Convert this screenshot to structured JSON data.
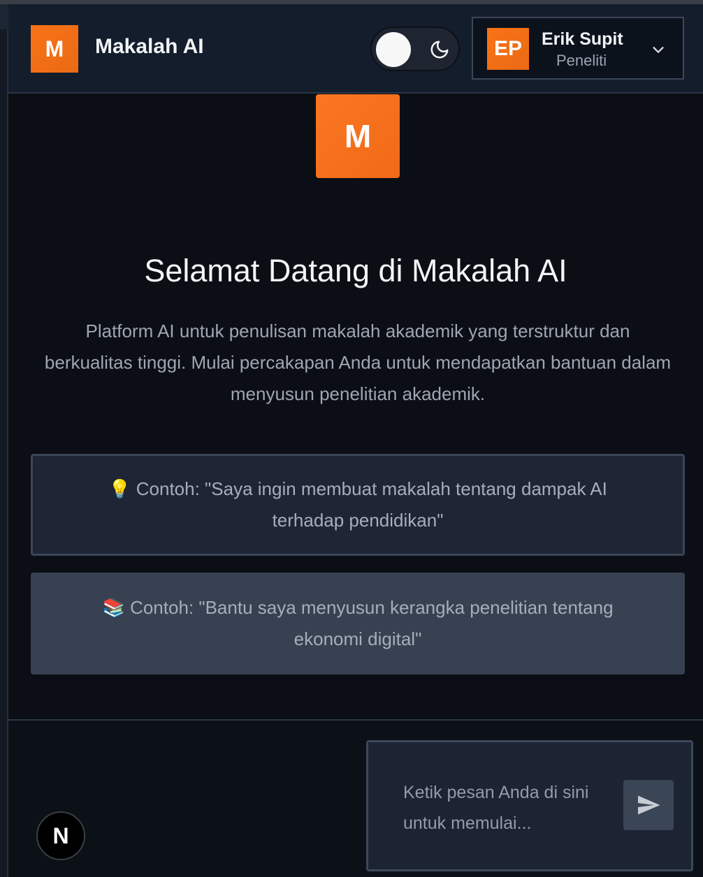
{
  "header": {
    "logo_letter": "M",
    "app_title": "Makalah AI",
    "theme_toggle": {
      "mode": "dark",
      "icon": "moon-icon"
    },
    "user": {
      "initials": "EP",
      "name": "Erik Supit",
      "role": "Peneliti",
      "menu_icon": "chevron-down-icon"
    }
  },
  "main": {
    "hero_letter": "M",
    "title": "Selamat Datang di Makalah AI",
    "description": "Platform AI untuk penulisan makalah akademik yang terstruktur dan berkualitas tinggi. Mulai percakapan Anda untuk mendapatkan bantuan dalam menyusun penelitian akademik.",
    "examples": [
      {
        "emoji": "💡",
        "text": "Contoh: \"Saya ingin membuat makalah tentang dampak AI terhadap pendidikan\""
      },
      {
        "emoji": "📚",
        "text": "Contoh: \"Bantu saya menyusun kerangka penelitian tentang ekonomi digital\""
      }
    ]
  },
  "composer": {
    "placeholder": "Ketik pesan Anda di sini untuk memulai...",
    "send_icon": "send-icon"
  },
  "dev_badge": {
    "letter": "N"
  },
  "colors": {
    "accent": "#f97316",
    "background": "#0b0e14",
    "header_bg": "#141d2b",
    "card_bg": "#1e2636",
    "card_alt_bg": "#374151"
  }
}
